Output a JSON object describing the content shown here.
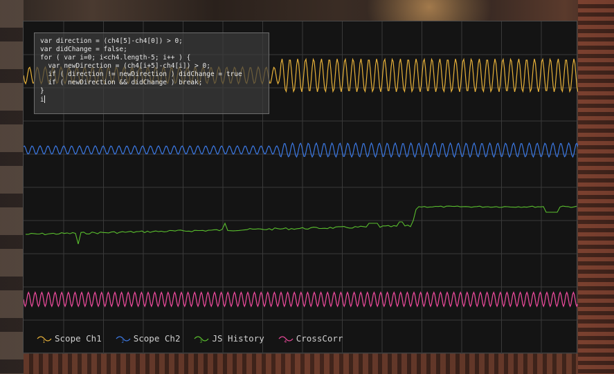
{
  "code_editor": {
    "lines": [
      "var direction = (ch4[5]-ch4[0]) > 0;",
      "var didChange = false;",
      "for ( var i=0; i<ch4.length-5; i++ ) {",
      "  var newDirection = (ch4[i+5]-ch4[i]) > 0;",
      "  if ( direction != newDirection ) didChange = true",
      "  if ( newDirection && didChange ) break;",
      "}",
      "i"
    ]
  },
  "legend": {
    "items": [
      {
        "index": "1",
        "label": "Scope Ch1",
        "color": "#e8b23a",
        "icon": "sine-wave-icon"
      },
      {
        "index": "2",
        "label": "Scope Ch2",
        "color": "#3c7ae6",
        "icon": "sine-wave-icon"
      },
      {
        "index": "3",
        "label": "JS History",
        "color": "#5ac02e",
        "icon": "sine-wave-icon"
      },
      {
        "index": "4",
        "label": "CrossCorr",
        "color": "#e84a9a",
        "icon": "sine-wave-icon"
      }
    ]
  },
  "colors": {
    "ch1": "#e8b23a",
    "ch2": "#3c7ae6",
    "ch3": "#5ac02e",
    "ch4": "#e84a9a",
    "grid": "#3a3a3a",
    "plot_bg": "#141414"
  }
}
